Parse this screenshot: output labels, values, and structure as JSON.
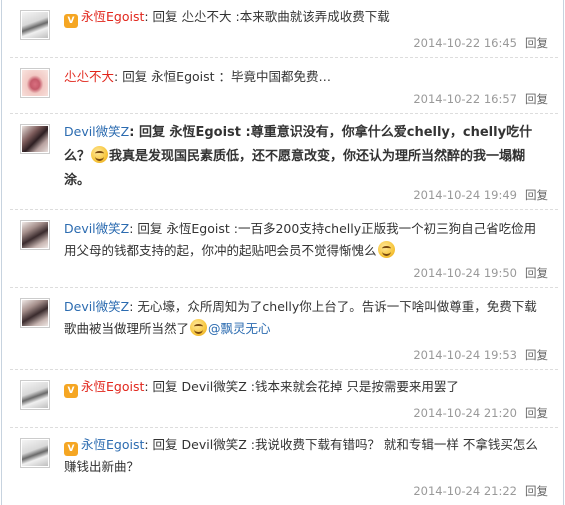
{
  "colors": {
    "name_red": "#e1261c",
    "name_blue": "#2b6bb0",
    "time_gray": "#999999",
    "vip_badge": "#f5a623"
  },
  "comments": [
    {
      "name": "永恆Egoist",
      "text": ": 回复 尐尐不大 :本来歌曲就该弄成收费下载",
      "time": "2014-10-22 16:45",
      "reply": "回复"
    },
    {
      "name": "尐尐不大",
      "text": ": 回复 永恒Egoist ：毕竟中国都免费…",
      "time": "2014-10-22 16:57",
      "reply": "回复"
    },
    {
      "name": "Devil微笑Z",
      "text_a": ": 回复 永恆Egoist :尊重意识没有，你拿什么爱chelly，chelly吃什么？",
      "text_b": "我真是发现国民素质低，还不愿意改变，你还认为理所当然醉的我一塌糊涂。",
      "time": "2014-10-24 19:49",
      "reply": "回复"
    },
    {
      "name": "Devil微笑Z",
      "text": ": 回复 永恆Egoist :一百多200支持chelly正版我一个初三狗自己省吃俭用用父母的钱都支持的起，你冲的起贴吧会员不觉得惭愧么",
      "time": "2014-10-24 19:50",
      "reply": "回复"
    },
    {
      "name": "Devil微笑Z",
      "text": ": 无心壕，众所周知为了chelly你上台了。告诉一下啥叫做尊重，免费下载歌曲被当做理所当然了",
      "mention": "@飘灵无心",
      "time": "2014-10-24 19:53",
      "reply": "回复"
    },
    {
      "name": "永恆Egoist",
      "text": ": 回复 Devil微笑Z :钱本来就会花掉 只是按需要来用罢了",
      "time": "2014-10-24 21:20",
      "reply": "回复"
    },
    {
      "name": "永恆Egoist",
      "text": ": 回复 Devil微笑Z :我说收费下载有错吗？ 就和专辑一样 不拿钱买怎么赚钱出新曲？",
      "time": "2014-10-24 21:22",
      "reply": "回复"
    }
  ]
}
